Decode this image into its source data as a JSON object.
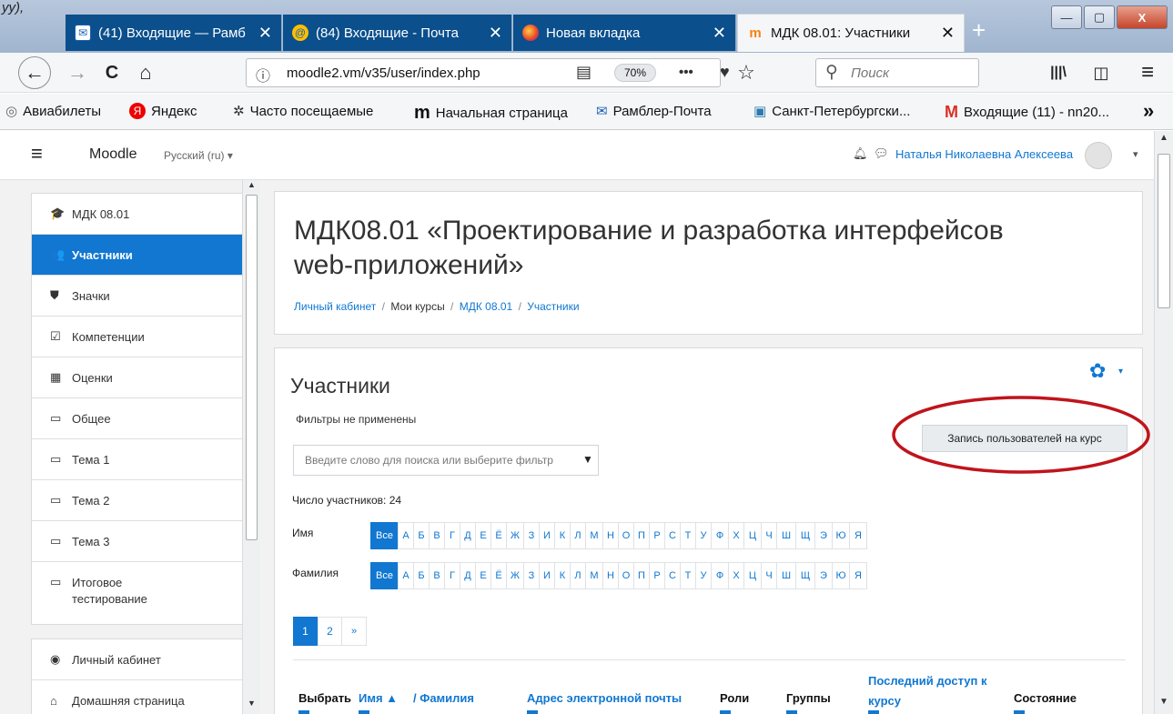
{
  "corner_text": "уу),",
  "tabs": [
    {
      "label": "(41) Входящие — Рамб",
      "close": "✕"
    },
    {
      "label": "(84) Входящие - Почта",
      "close": "✕"
    },
    {
      "label": "Новая вкладка",
      "close": "✕"
    },
    {
      "label": "МДК 08.01: Участники",
      "close": "✕"
    }
  ],
  "new_tab": "+",
  "window": {
    "min": "—",
    "max": "▢",
    "close": "X"
  },
  "nav": {
    "back": "←",
    "forward": "→",
    "reload": "C",
    "home": "⌂",
    "info": "ⓘ",
    "url": "moodle2.vm/v35/user/index.php",
    "reader": "▤",
    "zoom": "70%",
    "more": "•••",
    "pocket": "♥",
    "star": "☆",
    "search_placeholder": "Поиск",
    "library": "|||\\",
    "sidebar": "◫",
    "menu": "≡"
  },
  "bookmarks": [
    {
      "label": "Авиабилеты",
      "icon": "◎"
    },
    {
      "label": "Яндекс",
      "icon": "Я"
    },
    {
      "label": "Часто посещаемые",
      "icon": "✲"
    },
    {
      "label": "Начальная страница",
      "icon": "m"
    },
    {
      "label": "Рамблер-Почта",
      "icon": "✉"
    },
    {
      "label": "Санкт-Петербургски...",
      "icon": "▣"
    },
    {
      "label": "Входящие (11) - nn20...",
      "icon": "M"
    }
  ],
  "bookmarks_more": "»",
  "moodle": {
    "hamburger": "≡",
    "brand": "Moodle",
    "lang": "Русский (ru) ▾",
    "user": "Наталья Николаевна Алексеева",
    "user_caret": "▾"
  },
  "sidebar": {
    "items": [
      {
        "label": "МДК 08.01",
        "icon": "🎓"
      },
      {
        "label": "Участники",
        "icon": "👥"
      },
      {
        "label": "Значки",
        "icon": "⛊"
      },
      {
        "label": "Компетенции",
        "icon": "☑"
      },
      {
        "label": "Оценки",
        "icon": "▦"
      },
      {
        "label": "Общее",
        "icon": "▭"
      },
      {
        "label": "Тема 1",
        "icon": "▭"
      },
      {
        "label": "Тема 2",
        "icon": "▭"
      },
      {
        "label": "Тема 3",
        "icon": "▭"
      },
      {
        "label": "Итоговое",
        "label2": "тестирование",
        "icon": "▭"
      }
    ],
    "items2": [
      {
        "label": "Личный кабинет",
        "icon": "◉"
      },
      {
        "label": "Домашняя страница",
        "icon": "⌂"
      }
    ]
  },
  "course": {
    "title_line1": "МДК08.01 «Проектирование и разработка интерфейсов",
    "title_line2": "web-приложений»",
    "breadcrumb": [
      {
        "label": "Личный кабинет"
      },
      {
        "label": "Мои курсы"
      },
      {
        "label": "МДК 08.01"
      },
      {
        "label": "Участники"
      }
    ],
    "sep": "/"
  },
  "participants": {
    "title": "Участники",
    "filters": "Фильтры не применены",
    "search_placeholder": "Введите слово для поиска или выберите фильтр",
    "enroll_button": "Запись пользователей на курс",
    "count": "Число участников: 24",
    "first_label": "Имя",
    "last_label": "Фамилия",
    "letters": [
      "Все",
      "А",
      "Б",
      "В",
      "Г",
      "Д",
      "Е",
      "Ё",
      "Ж",
      "З",
      "И",
      "К",
      "Л",
      "М",
      "Н",
      "О",
      "П",
      "Р",
      "С",
      "Т",
      "У",
      "Ф",
      "Х",
      "Ц",
      "Ч",
      "Ш",
      "Щ",
      "Э",
      "Ю",
      "Я"
    ],
    "pages": [
      "1",
      "2",
      "»"
    ],
    "columns": {
      "select": "Выбрать",
      "first": "Имя ▲",
      "last": "/ Фамилия",
      "email": "Адрес электронной почты",
      "roles": "Роли",
      "groups": "Группы",
      "access1": "Последний доступ к",
      "access2": "курсу",
      "status": "Состояние"
    }
  },
  "colors": {
    "accent": "#1177d1",
    "tab_dark": "#0b4f8c",
    "annotation": "#c0141b"
  }
}
